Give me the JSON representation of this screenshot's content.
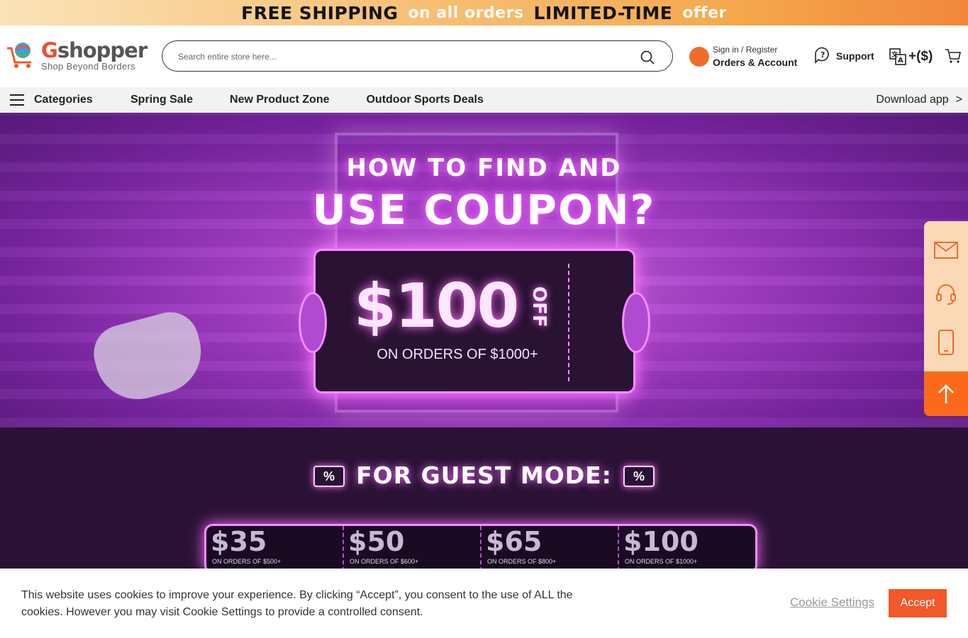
{
  "promo": {
    "part1": "FREE SHIPPING",
    "part2": "on all orders",
    "part3": "LIMITED-TIME",
    "part4": "offer"
  },
  "header": {
    "logo_name": "Gshopper",
    "logo_g": "G",
    "logo_rest": "shopper",
    "tagline": "Shop Beyond Borders",
    "search_placeholder": "Search entire store here...",
    "signin": "Sign in / Register",
    "orders": "Orders & Account",
    "support": "Support",
    "currency": "+($)"
  },
  "nav": {
    "categories": "Categories",
    "items": [
      "Spring Sale",
      "New Product Zone",
      "Outdoor Sports Deals"
    ],
    "download": "Download app",
    "download_arrow": ">"
  },
  "hero": {
    "title_small": "HOW TO FIND AND",
    "title_big": "USE COUPON?",
    "amount": "$100",
    "off": "OFF",
    "condition": "ON ORDERS OF $1000+"
  },
  "guest": {
    "title": "FOR GUEST MODE:",
    "coupons": [
      {
        "value": "$35",
        "cond": "ON ORDERS OF $500+"
      },
      {
        "value": "$50",
        "cond": "ON ORDERS OF $600+"
      },
      {
        "value": "$65",
        "cond": "ON ORDERS OF $800+"
      },
      {
        "value": "$100",
        "cond": "ON ORDERS OF $1000+"
      }
    ]
  },
  "sidebar": {
    "icons": [
      "mail-icon",
      "headset-icon",
      "phone-icon",
      "arrow-up-icon"
    ]
  },
  "cookie": {
    "text": "This website uses cookies to improve your experience. By clicking “Accept”, you consent to the use of ALL the cookies. However you may visit Cookie Settings to provide a controlled consent.",
    "settings": "Cookie Settings",
    "accept": "Accept"
  },
  "colors": {
    "accent": "#f2582a",
    "neon": "#f68cff",
    "purple": "#2a1235"
  }
}
